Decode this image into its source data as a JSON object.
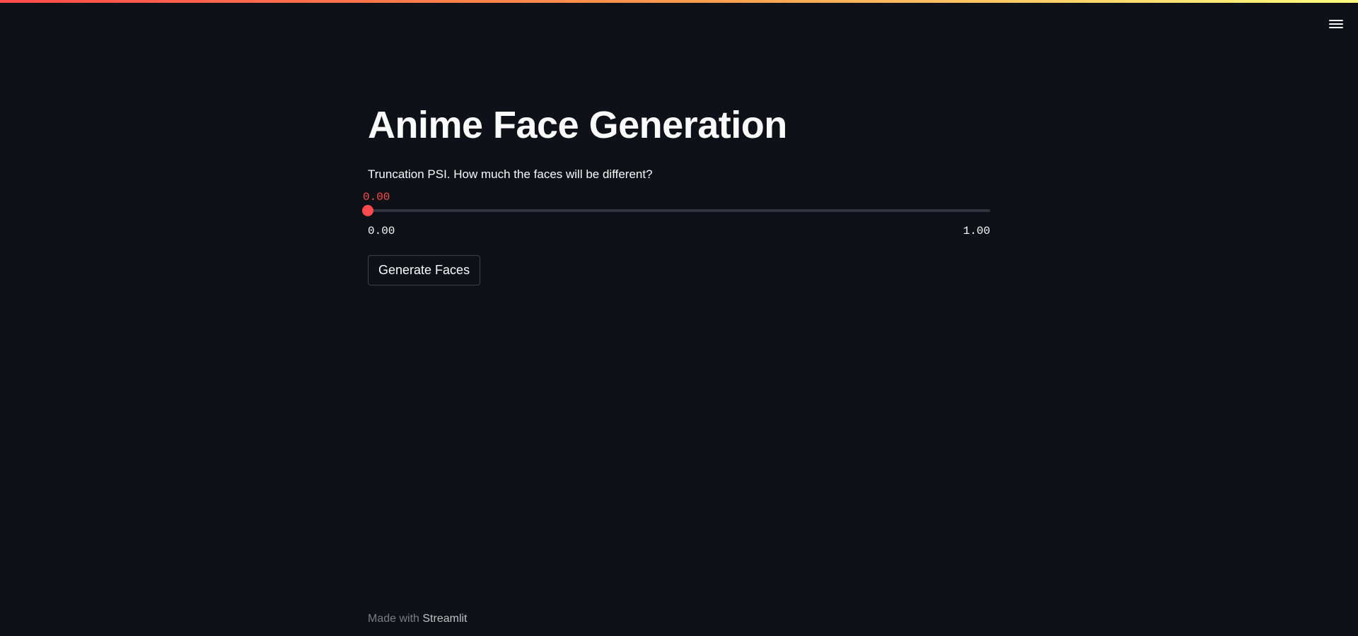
{
  "header": {
    "menu_icon": "hamburger-menu-icon",
    "accent_gradient": [
      "#ff4b4b",
      "#ff9a4d",
      "#fffd80"
    ]
  },
  "main": {
    "title": "Anime Face Generation",
    "slider": {
      "label": "Truncation PSI. How much the faces will be different?",
      "value_display": "0.00",
      "value": 0.0,
      "min": 0.0,
      "max": 1.0,
      "min_label": "0.00",
      "max_label": "1.00",
      "accent_color": "#ff4b4b"
    },
    "button_label": "Generate Faces"
  },
  "footer": {
    "prefix": "Made with",
    "link_text": "Streamlit"
  },
  "colors": {
    "background": "#0e1117",
    "text": "#fafafa",
    "accent": "#ff4b4b"
  }
}
